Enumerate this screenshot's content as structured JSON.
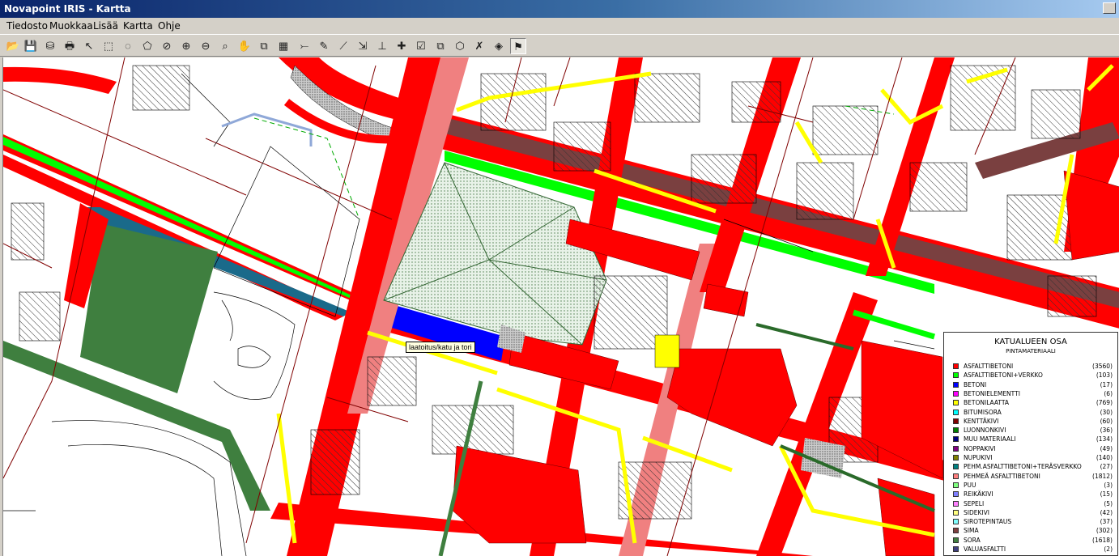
{
  "window": {
    "title": "Novapoint IRIS - Kartta"
  },
  "menu": [
    "Tiedosto",
    "Muokkaa",
    "Lisää",
    "Kartta",
    "Ohje"
  ],
  "toolbar": {
    "icons": [
      "open-folder-icon",
      "save-disk-icon",
      "database-icon",
      "print-icon",
      "pointer-icon",
      "select-box-icon",
      "select-circle-icon",
      "select-polygon-icon",
      "stop-icon",
      "zoom-in-icon",
      "zoom-out-icon",
      "zoom-extent-icon",
      "pan-hand-icon",
      "layers-icon",
      "attribute-table-icon",
      "measure-line-icon",
      "edit-pencil-icon",
      "edit-vertex-icon",
      "move-object-icon",
      "split-object-icon",
      "new-object-icon",
      "edit-form-icon",
      "copy-object-icon",
      "polygon-select-icon",
      "delete-point-icon",
      "thematic-map-icon",
      "info-pointer-icon"
    ],
    "glyphs": [
      "📂",
      "💾",
      "⛁",
      "🖶",
      "↖",
      "⬚",
      "◌",
      "⬠",
      "⊘",
      "⊕",
      "⊖",
      "⌕",
      "✋",
      "⧉",
      "▦",
      "⤚",
      "✎",
      "⟋",
      "⇲",
      "⊥",
      "✚",
      "☑",
      "⧉",
      "⬡",
      "✗",
      "◈",
      "⚑"
    ],
    "active_index": 26
  },
  "map": {
    "tooltip": "laatoitus/katu ja tori"
  },
  "legend": {
    "title": "KATUALUEEN OSA",
    "subtitle": "PINTAMATERIAALI",
    "items": [
      {
        "name": "ASFALTTIBETONI",
        "count": "(3560)",
        "color": "#ff0000"
      },
      {
        "name": "ASFALTTIBETONI+VERKKO",
        "count": "(103)",
        "color": "#00ff00"
      },
      {
        "name": "BETONI",
        "count": "(17)",
        "color": "#0000ff"
      },
      {
        "name": "BETONIELEMENTTI",
        "count": "(6)",
        "color": "#ff00ff"
      },
      {
        "name": "BETONILAATTA",
        "count": "(769)",
        "color": "#ffff00"
      },
      {
        "name": "BITUMISORA",
        "count": "(30)",
        "color": "#00ffff"
      },
      {
        "name": "KENTTÄKIVI",
        "count": "(60)",
        "color": "#800000"
      },
      {
        "name": "LUONNONKIVI",
        "count": "(36)",
        "color": "#008000"
      },
      {
        "name": "MUU MATERIAALI",
        "count": "(134)",
        "color": "#000080"
      },
      {
        "name": "NOPPAKIVI",
        "count": "(49)",
        "color": "#800080"
      },
      {
        "name": "NUPUKIVI",
        "count": "(140)",
        "color": "#808000"
      },
      {
        "name": "PEHM.ASFALTTIBETONI+TERÄSVERKKO",
        "count": "(27)",
        "color": "#008080"
      },
      {
        "name": "PEHMEÄ ASFALTTIBETONI",
        "count": "(1812)",
        "color": "#ff8080"
      },
      {
        "name": "PUU",
        "count": "(3)",
        "color": "#80ff80"
      },
      {
        "name": "REIKÄKIVI",
        "count": "(15)",
        "color": "#8080ff"
      },
      {
        "name": "SEPELI",
        "count": "(5)",
        "color": "#ff80ff"
      },
      {
        "name": "SIDEKIVI",
        "count": "(42)",
        "color": "#ffff80"
      },
      {
        "name": "SIROTEPINTAUS",
        "count": "(37)",
        "color": "#80ffff"
      },
      {
        "name": "SIMA",
        "count": "(302)",
        "color": "#804040"
      },
      {
        "name": "SORA",
        "count": "(1618)",
        "color": "#408040"
      },
      {
        "name": "VALUASFALTTI",
        "count": "(2)",
        "color": "#404080"
      }
    ]
  }
}
